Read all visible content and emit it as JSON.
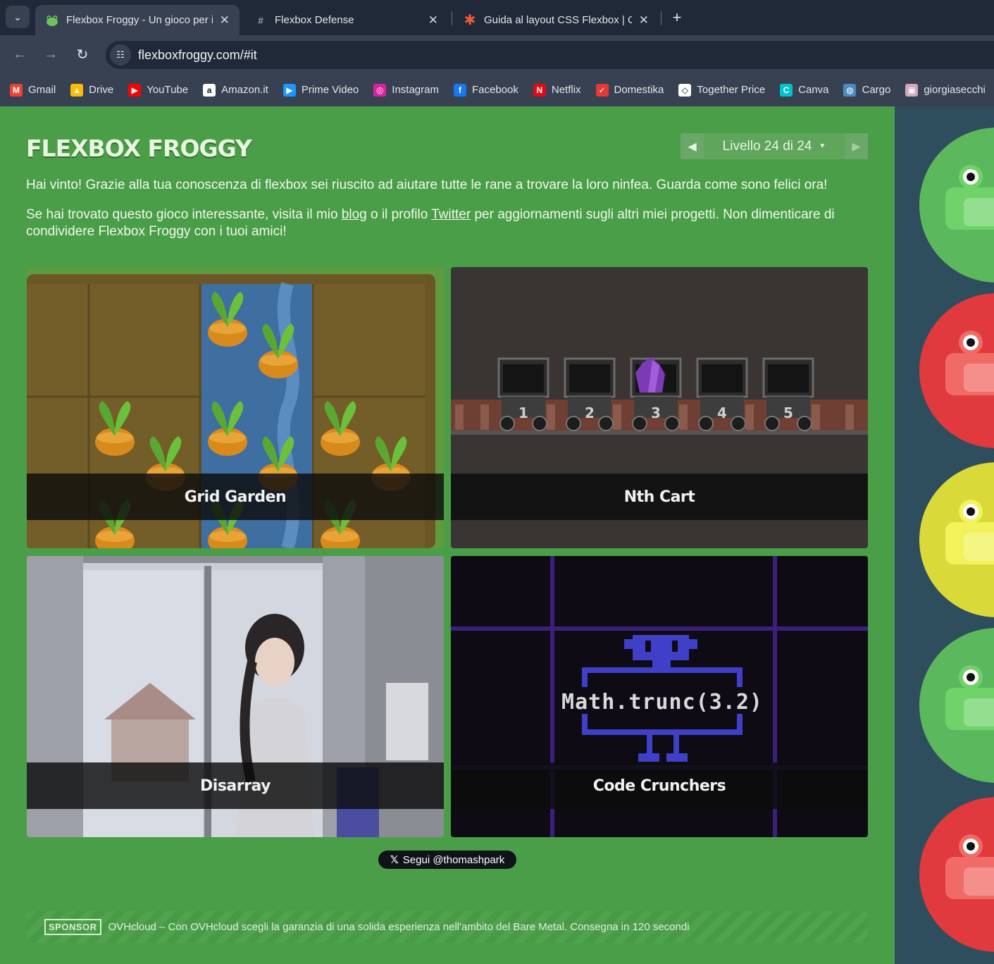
{
  "browser": {
    "tabs": [
      {
        "title": "Flexbox Froggy - Un gioco per i",
        "favicon": "frog-icon",
        "active": true
      },
      {
        "title": "Flexbox Defense",
        "favicon": "hash-icon",
        "active": false
      },
      {
        "title": "Guida al layout CSS Flexbox | CS",
        "favicon": "asterisk-icon",
        "active": false
      }
    ],
    "url": "flexboxfroggy.com/#it",
    "bookmarks": [
      {
        "label": "Gmail",
        "icon": "gmail-icon",
        "color": "#ea4335",
        "glyph": "M"
      },
      {
        "label": "Drive",
        "icon": "drive-icon",
        "color": "#fbbc04",
        "glyph": "▲"
      },
      {
        "label": "YouTube",
        "icon": "youtube-icon",
        "color": "#ff0000",
        "glyph": "▶"
      },
      {
        "label": "Amazon.it",
        "icon": "amazon-icon",
        "color": "#ffffff",
        "glyph": "a"
      },
      {
        "label": "Prime Video",
        "icon": "prime-video-icon",
        "color": "#1a98ff",
        "glyph": "▶"
      },
      {
        "label": "Instagram",
        "icon": "instagram-icon",
        "color": "#d6249f",
        "glyph": "◎"
      },
      {
        "label": "Facebook",
        "icon": "facebook-icon",
        "color": "#1877f2",
        "glyph": "f"
      },
      {
        "label": "Netflix",
        "icon": "netflix-icon",
        "color": "#e50914",
        "glyph": "N"
      },
      {
        "label": "Domestika",
        "icon": "domestika-icon",
        "color": "#e53935",
        "glyph": "✓"
      },
      {
        "label": "Together Price",
        "icon": "together-price-icon",
        "color": "#ffffff",
        "glyph": "◇"
      },
      {
        "label": "Canva",
        "icon": "canva-icon",
        "color": "#00c4cc",
        "glyph": "C"
      },
      {
        "label": "Cargo",
        "icon": "cargo-icon",
        "color": "#4b8bbe",
        "glyph": "◍"
      },
      {
        "label": "giorgiasecchi",
        "icon": "profile-icon",
        "color": "#d1a6b8",
        "glyph": "▣"
      }
    ]
  },
  "game": {
    "logo": "FLEXBOX FROGGY",
    "level_label": "Livello 24 di 24",
    "win_message": "Hai vinto! Grazie alla tua conoscenza di flexbox sei riuscito ad aiutare tutte le rane a trovare la loro ninfea. Guarda come sono felici ora!",
    "share_before_blog": "Se hai trovato questo gioco interessante, visita il mio ",
    "blog_link": "blog",
    "share_middle": " o il profilo ",
    "twitter_link": "Twitter",
    "share_after": " per aggiornamenti sugli altri miei progetti. Non dimenticare di condividere Flexbox Froggy con i tuoi amici!",
    "cards": [
      {
        "title": "Grid Garden"
      },
      {
        "title": "Nth Cart"
      },
      {
        "title": "Disarray"
      },
      {
        "title": "Code Crunchers"
      }
    ],
    "nth_cart_numbers": [
      "1",
      "2",
      "3",
      "4",
      "5"
    ],
    "code_snippet": "Math.trunc(3.2)",
    "follow_button": "Segui @thomashpark",
    "sponsor_tag": "SPONSOR",
    "sponsor_text": "OVHcloud – Con OVHcloud scegli la garanzia di una solida esperienza nell'ambito del Bare Metal. Consegna in 120 secondi"
  },
  "colors": {
    "page_green": "#4a9e48",
    "pond_blue": "#2e4d5d",
    "frog_green": "#5cb85c",
    "frog_red": "#e0393e",
    "frog_yellow": "#d9d93a"
  }
}
